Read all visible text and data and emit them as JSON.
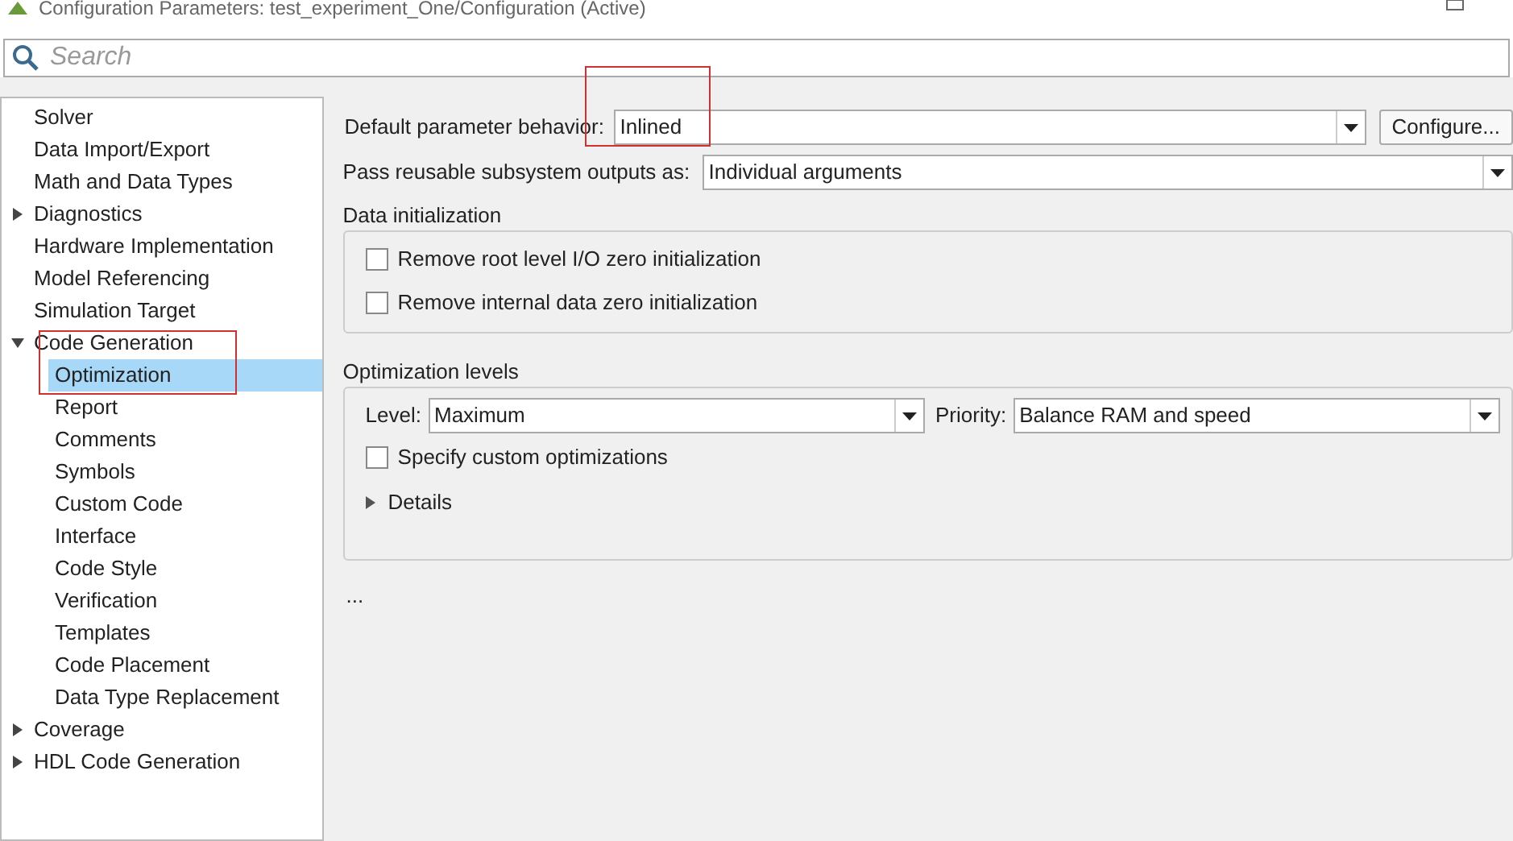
{
  "window": {
    "title": "Configuration Parameters: test_experiment_One/Configuration (Active)"
  },
  "search": {
    "placeholder": "Search"
  },
  "sidebar": {
    "items": [
      {
        "label": "Solver",
        "selected": false
      },
      {
        "label": "Data Import/Export",
        "selected": false
      },
      {
        "label": "Math and Data Types",
        "selected": false
      },
      {
        "label": "Diagnostics",
        "selected": false,
        "expanded": false
      },
      {
        "label": "Hardware Implementation",
        "selected": false
      },
      {
        "label": "Model Referencing",
        "selected": false
      },
      {
        "label": "Simulation Target",
        "selected": false
      },
      {
        "label": "Code Generation",
        "selected": false,
        "expanded": true,
        "children": [
          {
            "label": "Optimization",
            "selected": true,
            "annotated": true
          },
          {
            "label": "Report",
            "selected": false
          },
          {
            "label": "Comments",
            "selected": false
          },
          {
            "label": "Symbols",
            "selected": false
          },
          {
            "label": "Custom Code",
            "selected": false
          },
          {
            "label": "Interface",
            "selected": false
          },
          {
            "label": "Code Style",
            "selected": false
          },
          {
            "label": "Verification",
            "selected": false
          },
          {
            "label": "Templates",
            "selected": false
          },
          {
            "label": "Code Placement",
            "selected": false
          },
          {
            "label": "Data Type Replacement",
            "selected": false
          }
        ]
      },
      {
        "label": "Coverage",
        "selected": false,
        "expanded": false
      },
      {
        "label": "HDL Code Generation",
        "selected": false,
        "expanded": false
      }
    ]
  },
  "main": {
    "default_parameter_behavior": {
      "label": "Default parameter behavior:",
      "value": "Inlined",
      "annotated": true,
      "button": "Configure..."
    },
    "pass_reusable_outputs": {
      "label": "Pass reusable subsystem outputs as:",
      "value": "Individual arguments"
    },
    "data_initialization": {
      "title": "Data initialization",
      "checkboxes": [
        {
          "label": "Remove root level I/O zero initialization",
          "checked": false
        },
        {
          "label": "Remove internal data zero initialization",
          "checked": false
        }
      ]
    },
    "optimization_levels": {
      "title": "Optimization levels",
      "level": {
        "label": "Level:",
        "value": "Maximum"
      },
      "priority": {
        "label": "Priority:",
        "value": "Balance RAM and speed"
      },
      "custom": {
        "label": "Specify custom optimizations",
        "checked": false
      },
      "details": {
        "label": "Details",
        "expanded": false
      }
    },
    "ellipsis": "..."
  }
}
